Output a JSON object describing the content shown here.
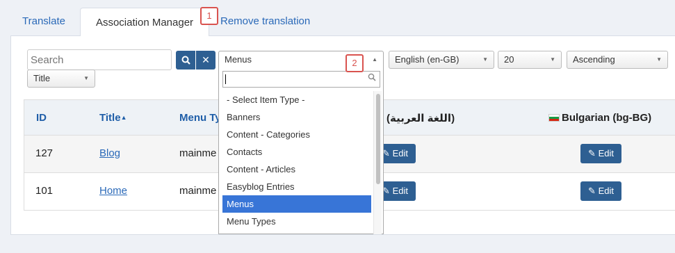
{
  "tabs": {
    "translate": "Translate",
    "association_manager": "Association Manager",
    "remove_translation": "Remove translation"
  },
  "callouts": {
    "one": "1",
    "two": "2"
  },
  "filters": {
    "search_placeholder": "Search",
    "search_icon": "search-icon",
    "clear_icon": "close-icon",
    "item_type_selected": "Menus",
    "language_selected": "English (en-GB)",
    "limit_selected": "20",
    "order_selected": "Ascending",
    "sort_selected": "Title"
  },
  "dropdown": {
    "items": [
      "- Select Item Type -",
      "Banners",
      "Content - Categories",
      "Contacts",
      "Content - Articles",
      "Easyblog Entries",
      "Menus",
      "Menu Types"
    ],
    "selected_index": 6
  },
  "table": {
    "headers": {
      "id": "ID",
      "title": "Title",
      "menu_type": "Menu Ty",
      "arabic": "(اللغة العربية)",
      "bulgarian": "Bulgarian (bg-BG)"
    },
    "sort_indicator": "▲",
    "rows": [
      {
        "id": "127",
        "title": "Blog",
        "menu_type": "mainme",
        "edit_ar": "Edit",
        "edit_bg": "Edit"
      },
      {
        "id": "101",
        "title": "Home",
        "menu_type": "mainme",
        "edit_ar": "Edit",
        "edit_bg": "Edit"
      }
    ]
  },
  "colors": {
    "accent": "#2e5f92",
    "link": "#2a69b8",
    "selected": "#3875d7",
    "callout": "#d9534f"
  }
}
